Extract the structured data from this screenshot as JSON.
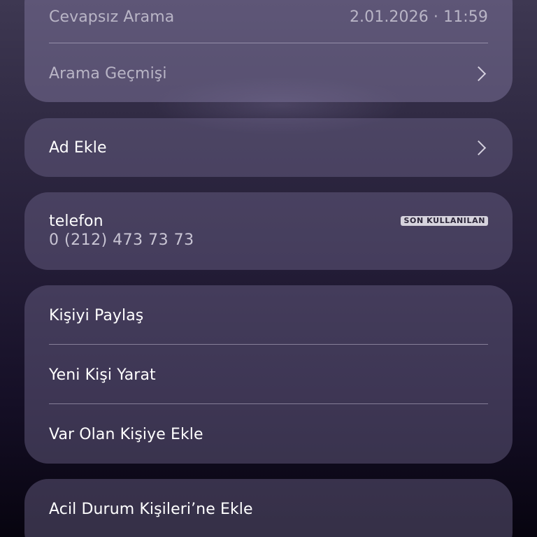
{
  "history_card": {
    "missed_call_label": "Cevapsız Arama",
    "missed_call_time": "2.01.2026 · 11:59",
    "call_history_label": "Arama Geçmişi"
  },
  "add_name": {
    "label": "Ad Ekle"
  },
  "phone": {
    "label": "telefon",
    "badge": "SON KULLANILAN",
    "number": "0 (212) 473 73 73"
  },
  "actions": {
    "share_contact": "Kişiyi Paylaş",
    "create_new_contact": "Yeni Kişi Yarat",
    "add_to_existing": "Var Olan Kişiye Ekle"
  },
  "emergency": {
    "label": "Acil Durum Kişileri’ne Ekle"
  },
  "icons": {
    "chevron": "chevron-right-icon"
  }
}
